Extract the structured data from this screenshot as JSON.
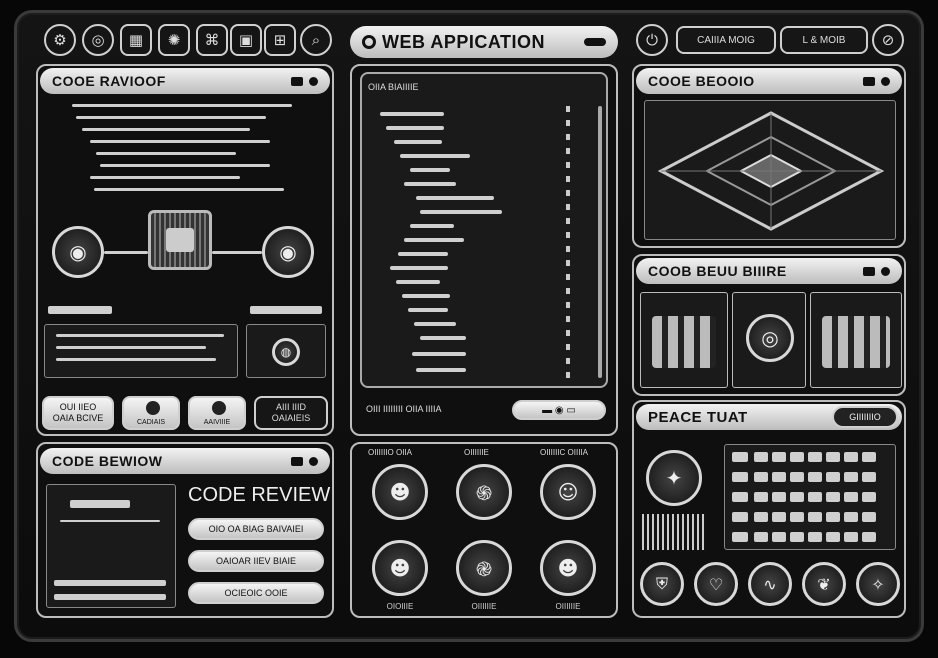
{
  "header": {
    "title": "WEB APPICATION",
    "right_pill_a": "CAIIIA MOIG",
    "right_pill_b": "L & MOIB",
    "icons": [
      "gear-icon",
      "compass-icon",
      "chip-icon",
      "gear-icon",
      "grid-icon",
      "chip-icon",
      "chip-icon",
      "search-icon"
    ]
  },
  "left_top": {
    "title": "COOE RAVIOOF",
    "buttons": [
      {
        "label": "OUI IIEO\nOAIA BCIVE"
      },
      {
        "label": "CADIAIS"
      },
      {
        "label": "AAIVIIIE"
      },
      {
        "label": "AIII IIID\nOAIAIEIS"
      }
    ]
  },
  "left_bottom": {
    "title": "CODE BEWIOW",
    "heading": "CODE REVIEW",
    "rows": [
      "OIO OA BIAG BAIVAIEI",
      "OAIOAR IIEV BIAIE",
      "OCIEOIC OOIE"
    ]
  },
  "center_top": {
    "header": "OIIA BIAIIIIE",
    "footer": "OIII IIIIIIII OIIA IIIIA"
  },
  "center_bottom": {
    "labels": [
      "OIIIIIIO OIIA",
      "OIIIIIIE",
      "OIIIIIIC OIIIIA"
    ],
    "captions": [
      "OIOIIIE",
      "OIIIIIIE",
      "OIIIIIIE"
    ]
  },
  "right_top": {
    "title": "COOE BEOOIO"
  },
  "right_mid": {
    "title": "COOB BEUU BIIIRE"
  },
  "right_bottom": {
    "title": "PEACE TUAT",
    "pill": "GIIIIIIIO"
  }
}
